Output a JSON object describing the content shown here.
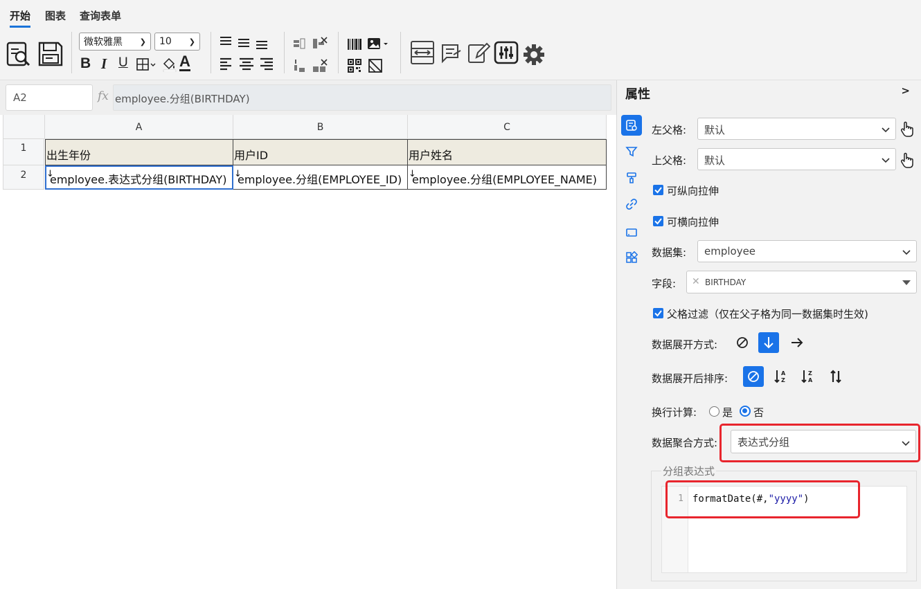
{
  "menu": {
    "tabs": [
      "开始",
      "图表",
      "查询表单"
    ]
  },
  "toolbar": {
    "font_family": "微软雅黑",
    "font_size": "10",
    "bold": "B",
    "italic": "I",
    "underline": "U",
    "font_color": "A"
  },
  "formula_bar": {
    "cell_ref": "A2",
    "fx": "fx",
    "formula": "employee.分组(BIRTHDAY)"
  },
  "sheet": {
    "columns": [
      "A",
      "B",
      "C"
    ],
    "rows": [
      "1",
      "2"
    ],
    "cells": {
      "a1": "出生年份",
      "b1": "用户ID",
      "c1": "用户姓名",
      "a2": "employee.表达式分组(BIRTHDAY)",
      "b2": "employee.分组(EMPLOYEE_ID)",
      "c2": "employee.分组(EMPLOYEE_NAME)"
    }
  },
  "panel": {
    "title": "属性",
    "collapse": ">",
    "left_parent_label": "左父格:",
    "left_parent_value": "默认",
    "top_parent_label": "上父格:",
    "top_parent_value": "默认",
    "vertical_stretch": "可纵向拉伸",
    "horizontal_stretch": "可横向拉伸",
    "dataset_label": "数据集:",
    "dataset_value": "employee",
    "field_label": "字段:",
    "field_value": "BIRTHDAY",
    "parent_filter": "父格过滤（仅在父子格为同一数据集时生效)",
    "expand_label": "数据展开方式:",
    "sort_label": "数据展开后排序:",
    "wrap_label": "换行计算:",
    "wrap_yes": "是",
    "wrap_no": "否",
    "aggregate_label": "数据聚合方式:",
    "aggregate_value": "表达式分组",
    "group_expr_legend": "分组表达式",
    "code_line_no": "1",
    "code_prefix": "formatDate(#,",
    "code_string": "\"yyyy\"",
    "code_suffix": ")"
  },
  "colors": {
    "accent": "#1a73e8",
    "highlight": "#e8252d",
    "header_fill": "#eeebe0"
  }
}
